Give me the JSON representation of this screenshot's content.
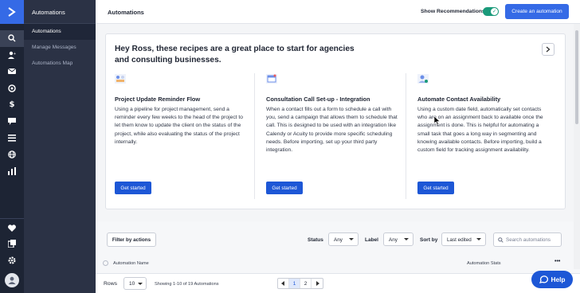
{
  "sidebar": {
    "section_title": "Automations",
    "items": [
      {
        "label": "Automations"
      },
      {
        "label": "Manage Messages"
      },
      {
        "label": "Automations Map"
      }
    ]
  },
  "header": {
    "title": "Automations",
    "recommendations_label": "Show Recommendations",
    "recommendations_on": true,
    "create_button": "Create an automation"
  },
  "recommendations": {
    "heading": "Hey Ross, these recipes are a great place to start for agencies and consulting businesses.",
    "recipes": [
      {
        "title": "Project Update Reminder Flow",
        "description": "Using a pipeline for project management, send a reminder every few weeks to the head of the project to let them know to update the client on the status of the project, while also evaluating the status of the project internally.",
        "button": "Get started"
      },
      {
        "title": "Consultation Call Set-up - Integration",
        "description": "When a contact fills out a form to schedule a call with you, send a campaign that allows them to schedule that call. This is designed to be used with an integration like Calendy or Acuity to provide more specific scheduling needs. Before importing, set up your third party integration.",
        "button": "Get started"
      },
      {
        "title": "Automate Contact Availability",
        "description": "Using a custom date field, automatically set contacts who are on an assignment back to available once the assignment is done. This is helpful for automating a small task that goes a long way in segmenting and knowing available contacts. Before importing, build a custom field for tracking assignment availability.",
        "button": "Get started"
      }
    ]
  },
  "filters": {
    "filter_button": "Filter by actions",
    "status_label": "Status",
    "status_value": "Any",
    "label_label": "Label",
    "label_value": "Any",
    "sort_label": "Sort by",
    "sort_value": "Last edited",
    "search_placeholder": "Search automations"
  },
  "table": {
    "columns": [
      "Automation Name",
      "Automation Stats"
    ],
    "more": "•••"
  },
  "footer": {
    "rows_label": "Rows",
    "rows_value": "10",
    "showing": "Showing 1-10 of 19 Automations",
    "pages": [
      "1",
      "2"
    ],
    "current_page": "1"
  },
  "help_button": "Help",
  "colors": {
    "accent": "#356ae6",
    "toggle": "#1a9a7a",
    "rail_bg": "#1d2434",
    "subnav_bg": "#2b3245"
  }
}
